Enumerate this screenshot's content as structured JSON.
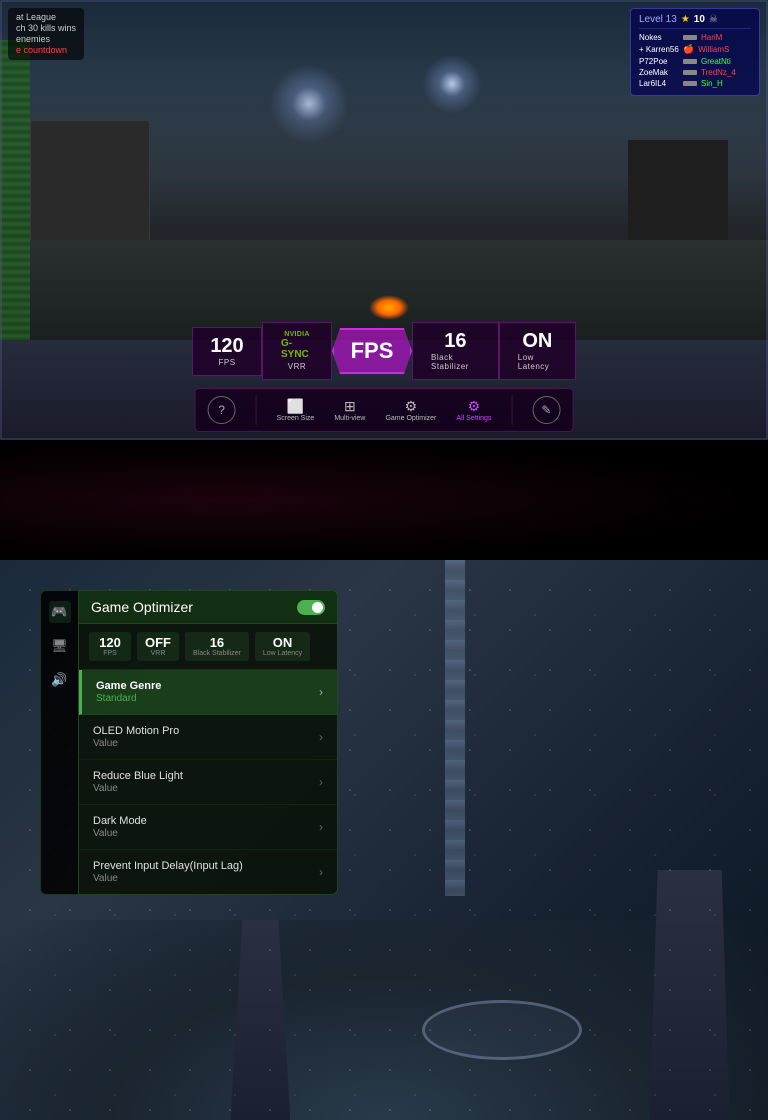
{
  "top": {
    "score_left": {
      "line1": "at League",
      "line2": "ch 30 kills wins",
      "line3": "enemies",
      "line4": "e countdown"
    },
    "scoreboard": {
      "level": "Level 13",
      "star_icon": "★",
      "skull_icon": "☠",
      "players": [
        {
          "name": "Nokes",
          "score": "HariM",
          "score_color": "red"
        },
        {
          "name": "+ Karren56",
          "score": "WilliamS",
          "score_color": "red"
        },
        {
          "name": "P72Poe",
          "score": "GreatNti",
          "score_color": "green"
        },
        {
          "name": "ZoeMak",
          "score": "TredNz_4",
          "score_color": "red"
        },
        {
          "name": "Lar6IL4",
          "score": "Sin_H",
          "score_color": "green"
        }
      ]
    },
    "stats": {
      "fps_value": "120",
      "fps_label": "FPS",
      "gsync_label": "NVIDIA",
      "gsync_brand": "G-SYNC",
      "gsync_sub": "VRR",
      "center_label": "FPS",
      "black_stab_value": "16",
      "black_stab_label": "Black Stabilizer",
      "low_latency_value": "ON",
      "low_latency_label": "Low Latency"
    },
    "menu": {
      "help_label": "?",
      "screen_size_label": "Screen Size",
      "multi_view_label": "Multi-view",
      "game_optimizer_label": "Game Optimizer",
      "all_settings_label": "All Settings",
      "edit_label": "✎"
    }
  },
  "bottom": {
    "optimizer": {
      "title": "Game Optimizer",
      "toggle_state": "on",
      "mini_stats": [
        {
          "value": "120",
          "label": "FPS"
        },
        {
          "value": "OFF",
          "label": "VRR"
        },
        {
          "value": "16",
          "label": "Black Stabilizer"
        },
        {
          "value": "ON",
          "label": "Low Latency"
        }
      ],
      "menu_items": [
        {
          "name": "Game Genre",
          "value": "Standard",
          "active": true
        },
        {
          "name": "OLED Motion Pro",
          "value": "Value",
          "active": false
        },
        {
          "name": "Reduce Blue Light",
          "value": "Value",
          "active": false
        },
        {
          "name": "Dark Mode",
          "value": "Value",
          "active": false
        },
        {
          "name": "Prevent Input Delay(Input Lag)",
          "value": "Value",
          "active": false
        }
      ]
    }
  }
}
